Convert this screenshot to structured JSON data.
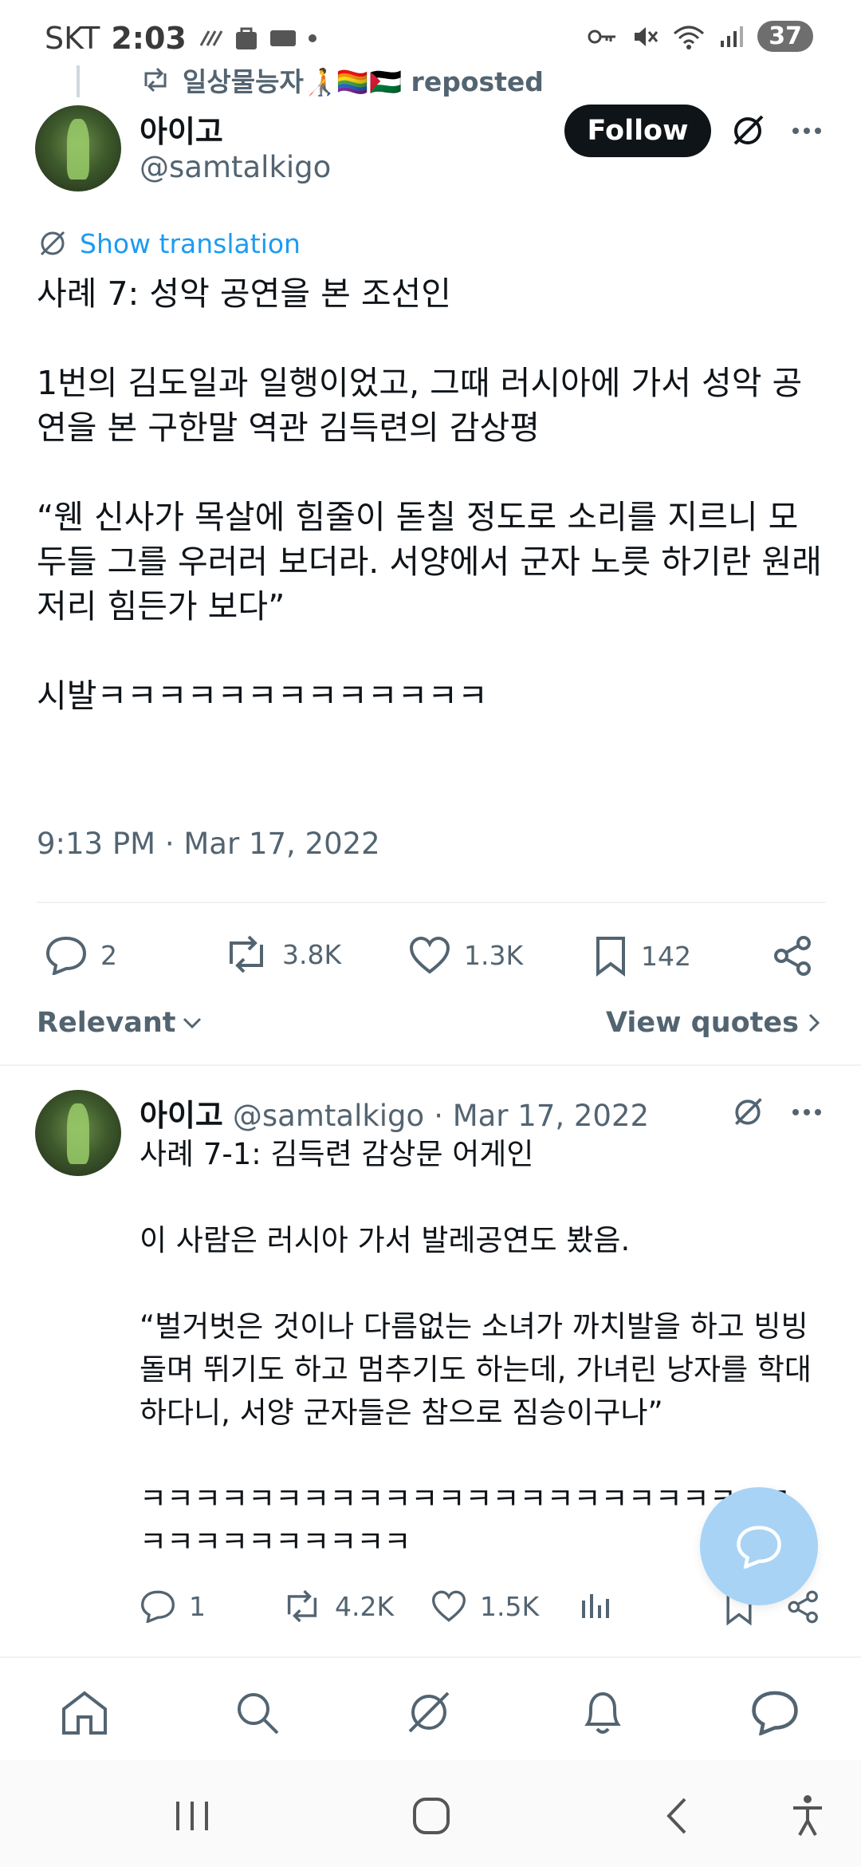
{
  "status_bar": {
    "carrier": "SKT",
    "time": "2:03",
    "battery": "37"
  },
  "repost": {
    "text": "일상물능자🧑‍🦯🏳️‍🌈🇵🇸 reposted"
  },
  "post": {
    "author_name": "아이고",
    "author_handle": "@samtalkigo",
    "follow_label": "Follow",
    "show_translation": "Show translation",
    "text": "사례 7: 성악 공연을 본 조선인\n\n1번의 김도일과 일행이었고, 그때 러시아에 가서 성악 공연을 본 구한말 역관 김득련의 감상평\n\n“웬 신사가 목살에 힘줄이 돋칠 정도로 소리를 지르니 모두들 그를 우러러 보더라. 서양에서 군자 노릇 하기란 원래 저리 힘든가 보다”\n\n시발ㅋㅋㅋㅋㅋㅋㅋㅋㅋㅋㅋㅋㅋ",
    "timestamp": "9:13 PM · Mar 17, 2022",
    "replies": "2",
    "reposts": "3.8K",
    "likes": "1.3K",
    "bookmarks": "142"
  },
  "sort": {
    "relevant_label": "Relevant",
    "view_quotes_label": "View quotes"
  },
  "reply": {
    "author_name": "아이고",
    "author_handle": "@samtalkigo",
    "date": "· Mar 17, 2022",
    "text": "사례 7-1: 김득련 감상문 어게인\n\n이 사람은 러시아 가서 발레공연도 봤음.\n\n“벌거벗은 것이나 다름없는 소녀가 까치발을 하고 빙빙 돌며 뛰기도 하고 멈추기도 하는데, 가녀린 낭자를 학대하다니, 서양 군자들은 참으로 짐승이구나”\n\nㅋㅋㅋㅋㅋㅋㅋㅋㅋㅋㅋㅋㅋㅋㅋㅋㅋㅋㅋㅋㅋㅋㅋㅋㅋㅋㅋㅋㅋㅋㅋㅋㅋㅋ",
    "replies": "1",
    "reposts": "4.2K",
    "likes": "1.5K"
  },
  "colors": {
    "accent": "#1d9bf0",
    "text": "#0f1419",
    "muted": "#536471",
    "fab": "#a8d3f5"
  }
}
